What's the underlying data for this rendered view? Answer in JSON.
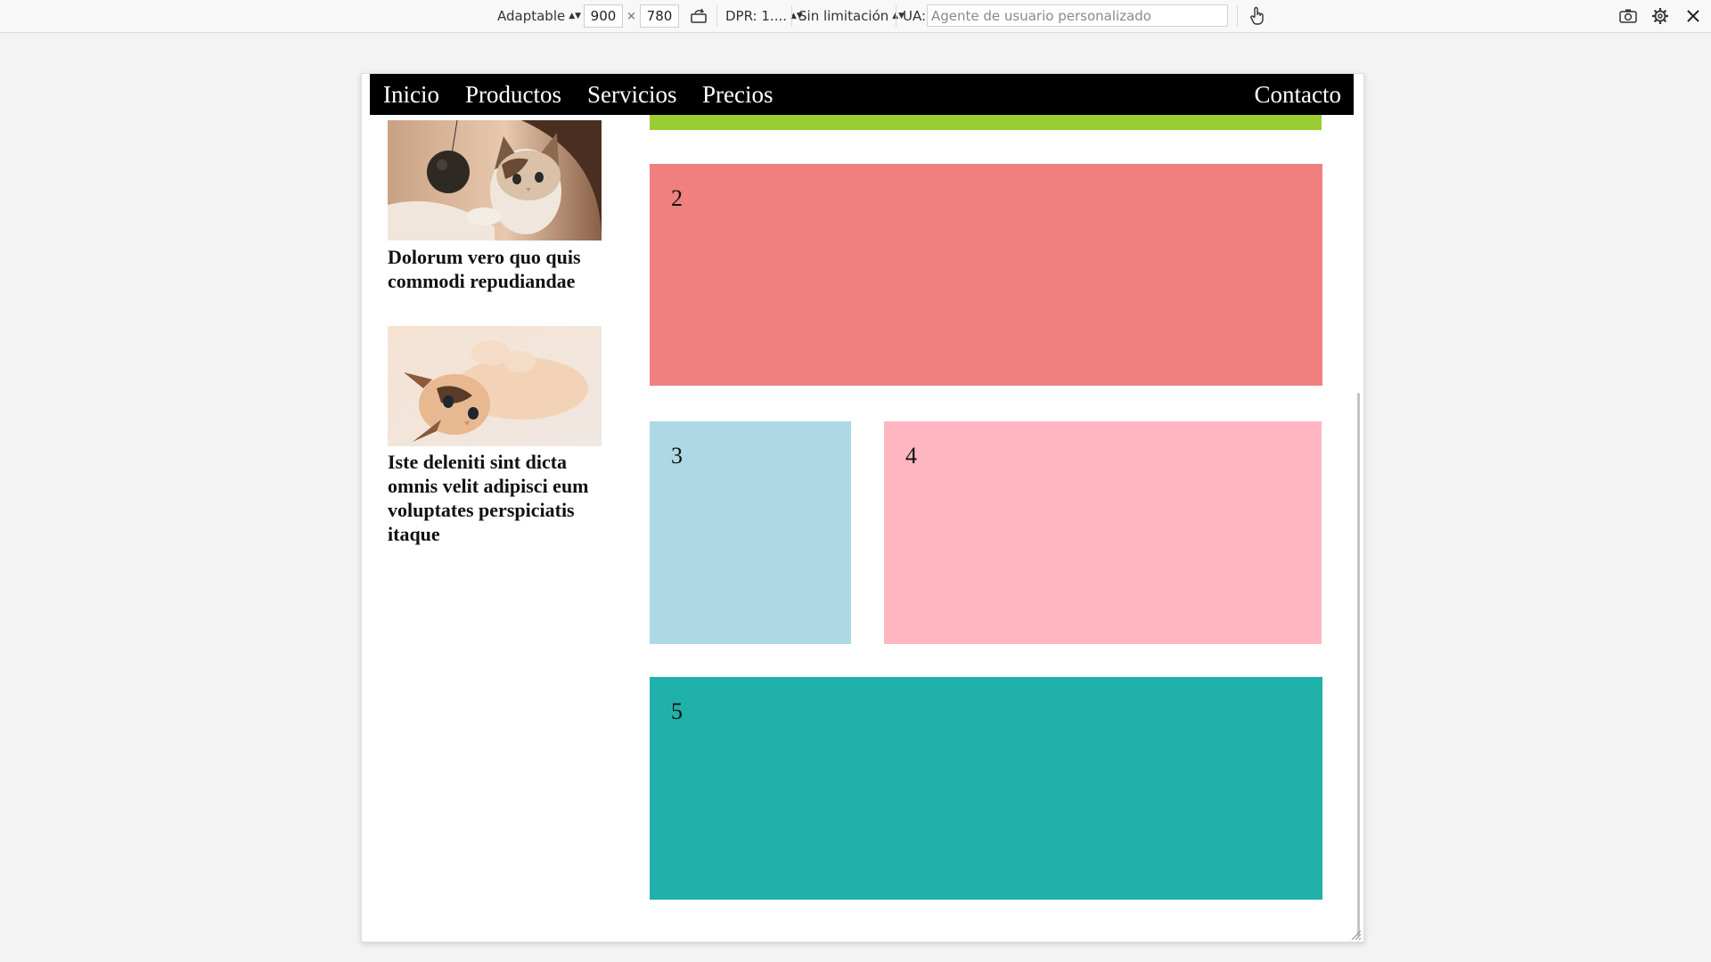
{
  "toolbar": {
    "device_mode": "Adaptable",
    "width": "900",
    "times": "×",
    "height": "780",
    "dpr": "DPR: 1....",
    "throttle": "Sin limitación",
    "ua_label": "UA:",
    "ua_placeholder": "Agente de usuario personalizado"
  },
  "nav": {
    "items": [
      "Inicio",
      "Productos",
      "Servicios",
      "Precios"
    ],
    "contact": "Contacto"
  },
  "sidebar": {
    "cards": [
      {
        "title": "Dolorum vero quo quis commodi repudiandae",
        "image": "kitten-with-yarn-ball"
      },
      {
        "title": "Iste deleniti sint dicta omnis velit adipisci eum voluptates perspiciatis itaque",
        "image": "kitten-lying-on-back"
      }
    ]
  },
  "boxes": [
    {
      "label": "2",
      "color": "#f08080"
    },
    {
      "label": "3",
      "color": "#add8e6"
    },
    {
      "label": "4",
      "color": "#ffb6c1"
    },
    {
      "label": "5",
      "color": "#20b2aa"
    }
  ],
  "colors": {
    "accent_bar": "#9acd32",
    "navbar": "#000000"
  }
}
